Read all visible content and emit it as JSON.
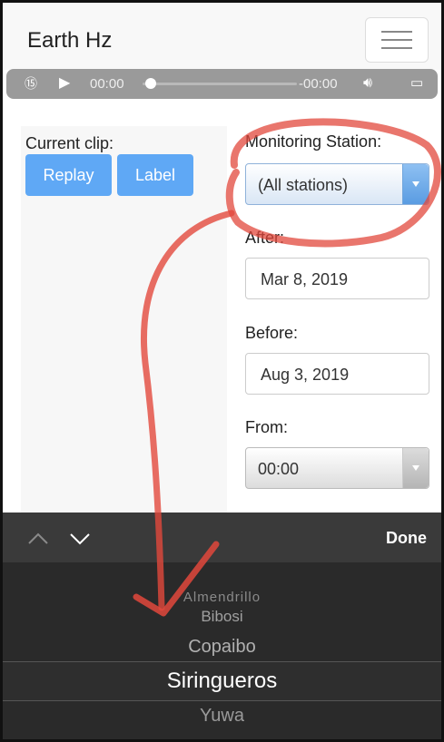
{
  "header": {
    "title": "Earth Hz",
    "menu_icon": "hamburger-icon"
  },
  "player": {
    "current_time": "00:00",
    "remaining_time": "-00:00",
    "progress": 0
  },
  "clip": {
    "label": "Current clip:",
    "replay_label": "Replay",
    "label_button": "Label"
  },
  "filters": {
    "station_label": "Monitoring Station:",
    "station_value": "(All stations)",
    "after_label": "After:",
    "after_value": "Mar 8, 2019",
    "before_label": "Before:",
    "before_value": "Aug 3, 2019",
    "from_label": "From:",
    "from_value": "00:00"
  },
  "picker": {
    "done_label": "Done",
    "items": [
      "Almendrillo",
      "Bibosi",
      "Copaibo",
      "Siringueros",
      "Yuwa"
    ],
    "selected": "Siringueros"
  },
  "colors": {
    "accent": "#5fa8f5",
    "annotation": "#e2483c"
  }
}
